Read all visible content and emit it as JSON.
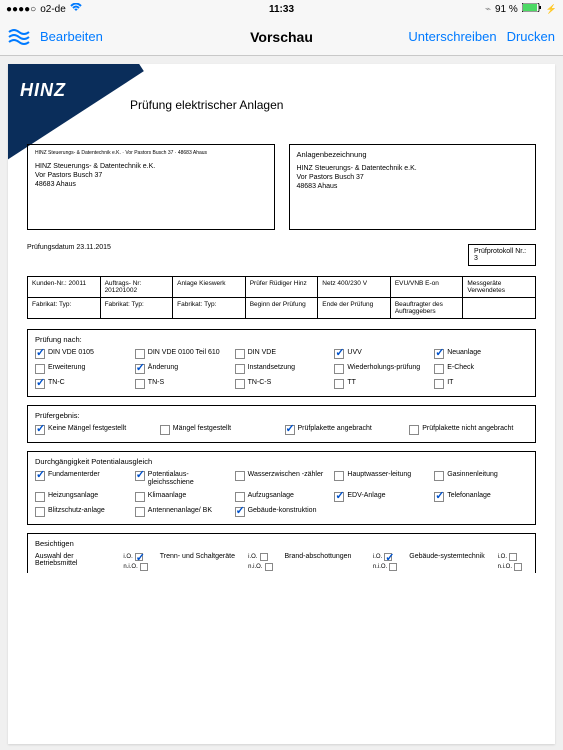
{
  "status": {
    "carrier": "o2-de",
    "time": "11:33",
    "battery_pct": "91 %"
  },
  "navbar": {
    "edit": "Bearbeiten",
    "title": "Vorschau",
    "sign": "Unterschreiben",
    "print": "Drucken"
  },
  "doc": {
    "logo": "HINZ",
    "title": "Prüfung elektrischer Anlagen",
    "left_box": {
      "header": "HINZ Steuerungs- & Datentechnik e.K. · Vor Pastors Busch 37 · 48683 Ahaus",
      "line1": "HINZ Steuerungs- & Datentechnik e.K.",
      "line2": "Vor Pastors Busch 37",
      "line3": "48683 Ahaus"
    },
    "right_box": {
      "title": "Anlagenbezeichnung",
      "line1": "HINZ Steuerungs- & Datentechnik e.K.",
      "line2": "Vor Pastors Busch 37",
      "line3": "48683 Ahaus"
    },
    "pruefdatum": "Prüfungsdatum 23.11.2015",
    "proto_label": "Prüfprotokoll Nr.:",
    "proto_no": "3",
    "info_row1": [
      "Kunden-Nr.: 20011",
      "Auftrags- Nr: 201201002",
      "Anlage Kieswerk",
      "Prüfer Rüdiger Hinz",
      "Netz 400/230 V",
      "EVU/VNB E-on",
      "Messgeräte Verwendetes"
    ],
    "info_row2": [
      "Fabrikat: Typ:",
      "Fabrikat: Typ:",
      "Fabrikat: Typ:",
      "Beginn der Prüfung",
      "Ende der Prüfung",
      "Beauftragter des Auftraggebers",
      ""
    ],
    "sections": {
      "pruefung_nach": {
        "title": "Prüfung nach:",
        "items": [
          {
            "label": "DIN VDE 0105",
            "checked": true
          },
          {
            "label": "DIN VDE 0100 Teil 610",
            "checked": false
          },
          {
            "label": "DIN VDE",
            "checked": false
          },
          {
            "label": "UVV",
            "checked": true
          },
          {
            "label": "Neuanlage",
            "checked": true
          },
          {
            "label": "Erweiterung",
            "checked": false
          },
          {
            "label": "Änderung",
            "checked": true
          },
          {
            "label": "Instandsetzung",
            "checked": false
          },
          {
            "label": "Wiederholungs-prüfung",
            "checked": false
          },
          {
            "label": "E-Check",
            "checked": false
          },
          {
            "label": "TN-C",
            "checked": true
          },
          {
            "label": "TN-S",
            "checked": false
          },
          {
            "label": "TN-C-S",
            "checked": false
          },
          {
            "label": "TT",
            "checked": false
          },
          {
            "label": "IT",
            "checked": false
          }
        ]
      },
      "pruefergebnis": {
        "title": "Prüfergebnis:",
        "items": [
          {
            "label": "Keine Mängel festgestellt",
            "checked": true
          },
          {
            "label": "Mängel festgestellt",
            "checked": false
          },
          {
            "label": "Prüfplakette angebracht",
            "checked": true
          },
          {
            "label": "Prüfplakette nicht angebracht",
            "checked": false
          }
        ]
      },
      "potential": {
        "title": "Durchgängigkeit Potentialausgleich",
        "items": [
          {
            "label": "Fundamenterder",
            "checked": true
          },
          {
            "label": "Potentialaus-gleichsschiene",
            "checked": true
          },
          {
            "label": "Wasserzwischen -zähler",
            "checked": false
          },
          {
            "label": "Hauptwasser-leitung",
            "checked": false
          },
          {
            "label": "Gasinnenleitung",
            "checked": false
          },
          {
            "label": "Heizungsanlage",
            "checked": false
          },
          {
            "label": "Klimaanlage",
            "checked": false
          },
          {
            "label": "Aufzugsanlage",
            "checked": false
          },
          {
            "label": "EDV-Anlage",
            "checked": true
          },
          {
            "label": "Telefonanlage",
            "checked": true
          },
          {
            "label": "Blitzschutz-anlage",
            "checked": false
          },
          {
            "label": "Antennenanlage/ BK",
            "checked": false
          },
          {
            "label": "Gebäude-konstruktion",
            "checked": true
          },
          {
            "label": "",
            "checked": false
          },
          {
            "label": "",
            "checked": false
          }
        ]
      },
      "besichtigen": {
        "title": "Besichtigen",
        "io": "i.O.",
        "nio": "n.i.O.",
        "items": [
          "Auswahl der Betriebsmittel",
          "Trenn- und Schaltgeräte",
          "Brand-abschottungen",
          "Gebäude-systemtechnik"
        ]
      }
    }
  }
}
